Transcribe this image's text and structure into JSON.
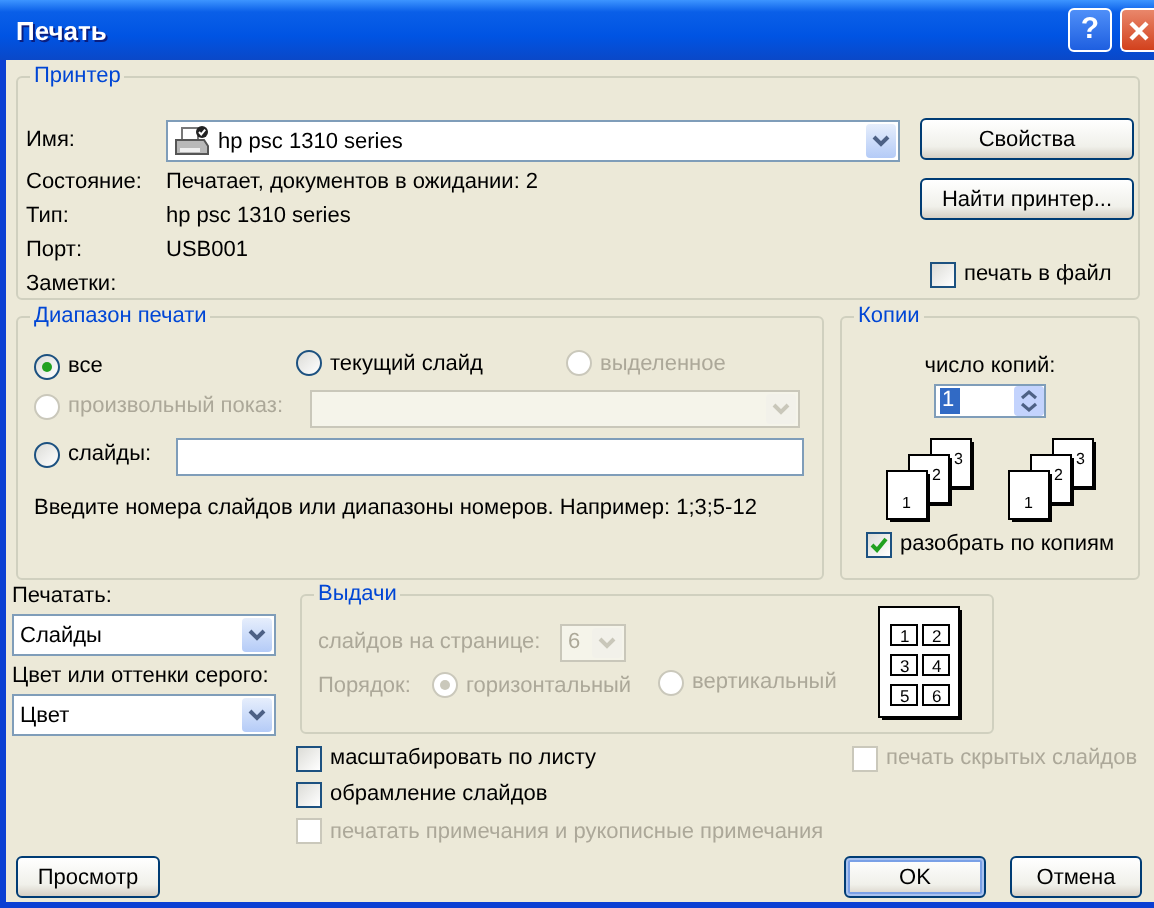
{
  "window": {
    "title": "Печать",
    "help": "?"
  },
  "printer": {
    "legend": "Принтер",
    "name_label": "Имя:",
    "name_value": "hp psc 1310 series",
    "details": [
      {
        "label": "Состояние:",
        "value": "Печатает, документов в ожидании: 2"
      },
      {
        "label": "Тип:",
        "value": "hp psc 1310 series"
      },
      {
        "label": "Порт:",
        "value": "USB001"
      },
      {
        "label": "Заметки:"
      }
    ],
    "properties_button": "Свойства",
    "find_button": "Найти принтер...",
    "print_to_file": {
      "label": "печать в файл",
      "checked": false
    }
  },
  "range": {
    "legend": "Диапазон печати",
    "options": [
      {
        "kind": "all",
        "label": "все",
        "selected": true,
        "disabled": false
      },
      {
        "kind": "current",
        "label": "текущий слайд",
        "selected": false,
        "disabled": false
      },
      {
        "kind": "selection",
        "label": "выделенное",
        "selected": false,
        "disabled": true
      },
      {
        "kind": "custom",
        "label": "произвольный показ:",
        "selected": false,
        "disabled": true
      },
      {
        "kind": "slides",
        "label": "слайды:",
        "selected": false,
        "disabled": false
      }
    ],
    "hint": "Введите номера слайдов или диапазоны номеров. Например: 1;3;5-12"
  },
  "copies": {
    "legend": "Копии",
    "count_label": "число копий:",
    "count_value": "1",
    "collate": {
      "label": "разобрать по копиям",
      "checked": true
    },
    "stacks": [
      [
        "1",
        "2",
        "3"
      ],
      [
        "1",
        "2",
        "3"
      ]
    ]
  },
  "print_what": {
    "label": "Печатать:",
    "value": "Слайды"
  },
  "color": {
    "label": "Цвет или оттенки серого:",
    "value": "Цвет"
  },
  "handouts": {
    "legend": "Выдачи",
    "disabled": true,
    "per_page_label": "слайдов на странице:",
    "per_page_value": "6",
    "order_label": "Порядок:",
    "orders": [
      {
        "label": "горизонтальный",
        "selected": true
      },
      {
        "label": "вертикальный",
        "selected": false
      }
    ],
    "preview": [
      "1",
      "2",
      "3",
      "4",
      "5",
      "6"
    ]
  },
  "options": [
    {
      "kind": "scale",
      "label": "масштабировать по листу",
      "checked": false,
      "disabled": false
    },
    {
      "kind": "hidden",
      "label": "печать скрытых слайдов",
      "checked": false,
      "disabled": true
    },
    {
      "kind": "frame",
      "label": "обрамление слайдов",
      "checked": false,
      "disabled": false
    },
    {
      "kind": "notes",
      "label": "печатать примечания и рукописные примечания",
      "checked": false,
      "disabled": true
    }
  ],
  "buttons": [
    {
      "kind": "preview",
      "label": "Просмотр",
      "default": false
    },
    {
      "kind": "ok",
      "label": "OK",
      "default": true
    },
    {
      "kind": "cancel",
      "label": "Отмена",
      "default": false
    }
  ]
}
